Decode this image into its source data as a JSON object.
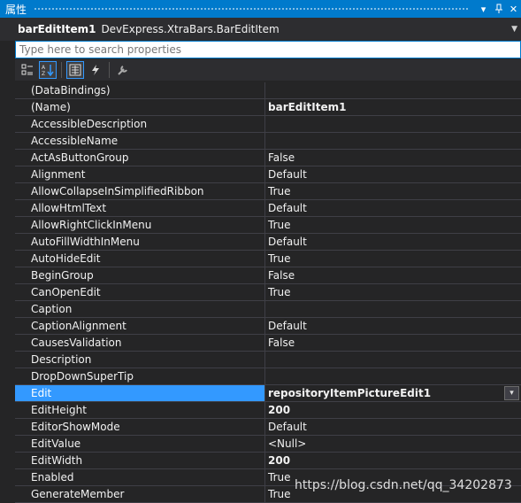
{
  "window": {
    "title": "属性",
    "dropdown_glyph": "▾",
    "pin_glyph": "ᵖ",
    "close_glyph": "✕"
  },
  "object": {
    "name": "barEditItem1",
    "type": "DevExpress.XtraBars.BarEditItem"
  },
  "search": {
    "placeholder": "Type here to search properties"
  },
  "toolbar": {
    "buttons": [
      "categorized-icon",
      "alphabetical-icon",
      "properties-icon",
      "events-icon",
      "property-pages-icon"
    ]
  },
  "properties": [
    {
      "name": "(DataBindings)",
      "value": "",
      "expandable": true
    },
    {
      "name": "(Name)",
      "value": "barEditItem1",
      "bold": true
    },
    {
      "name": "AccessibleDescription",
      "value": ""
    },
    {
      "name": "AccessibleName",
      "value": ""
    },
    {
      "name": "ActAsButtonGroup",
      "value": "False"
    },
    {
      "name": "Alignment",
      "value": "Default"
    },
    {
      "name": "AllowCollapseInSimplifiedRibbon",
      "value": "True"
    },
    {
      "name": "AllowHtmlText",
      "value": "Default"
    },
    {
      "name": "AllowRightClickInMenu",
      "value": "True"
    },
    {
      "name": "AutoFillWidthInMenu",
      "value": "Default"
    },
    {
      "name": "AutoHideEdit",
      "value": "True"
    },
    {
      "name": "BeginGroup",
      "value": "False"
    },
    {
      "name": "CanOpenEdit",
      "value": "True"
    },
    {
      "name": "Caption",
      "value": ""
    },
    {
      "name": "CaptionAlignment",
      "value": "Default"
    },
    {
      "name": "CausesValidation",
      "value": "False"
    },
    {
      "name": "Description",
      "value": ""
    },
    {
      "name": "DropDownSuperTip",
      "value": ""
    },
    {
      "name": "Edit",
      "value": "repositoryItemPictureEdit1",
      "bold": true,
      "expandable": true,
      "selected": true
    },
    {
      "name": "EditHeight",
      "value": "200",
      "bold": true
    },
    {
      "name": "EditorShowMode",
      "value": "Default"
    },
    {
      "name": "EditValue",
      "value": "<Null>"
    },
    {
      "name": "EditWidth",
      "value": "200",
      "bold": true
    },
    {
      "name": "Enabled",
      "value": "True"
    },
    {
      "name": "GenerateMember",
      "value": "True"
    }
  ],
  "watermark": "https://blog.csdn.net/qq_34202873",
  "colors": {
    "accent": "#007acc",
    "selection": "#3399ff",
    "background": "#252526"
  }
}
